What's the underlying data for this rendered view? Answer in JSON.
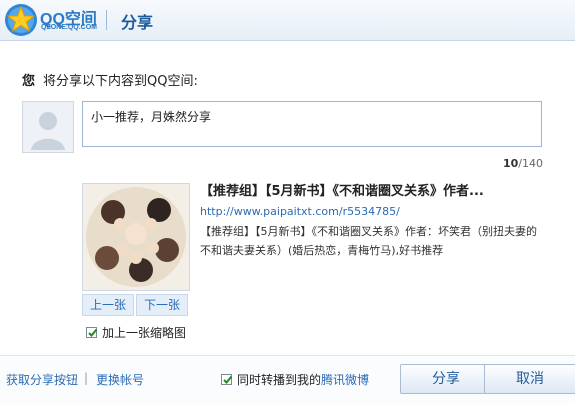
{
  "header": {
    "logo_main": "QQ空间",
    "logo_sub": "QZONE.QQ.COM",
    "title": "分享"
  },
  "prompt": {
    "who": "您",
    "text": "将分享以下内容到QQ空间:"
  },
  "comment": {
    "value": "小一推荐，月姝然分享",
    "count_current": "10",
    "count_max": "/140"
  },
  "share": {
    "title": "【推荐组】【5月新书】《不和谐圈叉关系》作者...",
    "url": "http://www.paipaitxt.com/r5534785/",
    "description": "【推荐组】【5月新书】《不和谐圈叉关系》作者：坏笑君（别扭夫妻的不和谐夫妻关系）(婚后热恋，青梅竹马),好书推荐"
  },
  "thumbnail_nav": {
    "prev": "上一张",
    "next": "下一张",
    "include_label": "加上一张缩略图",
    "include_checked": true
  },
  "footer": {
    "get_button_link": "获取分享按钮",
    "separator": "|",
    "switch_account_link": "更换帐号",
    "weibo_prefix": "同时转播到我的",
    "weibo_link": "腾讯微博",
    "weibo_checked": true,
    "share_button": "分享",
    "cancel_button": "取消"
  },
  "colors": {
    "accent": "#2b6bb5",
    "header_bg": "#e6eef7",
    "button_bg": "#dde8f4"
  },
  "icons": [
    "qq-zone-star-logo",
    "default-avatar",
    "checkbox-checked"
  ]
}
